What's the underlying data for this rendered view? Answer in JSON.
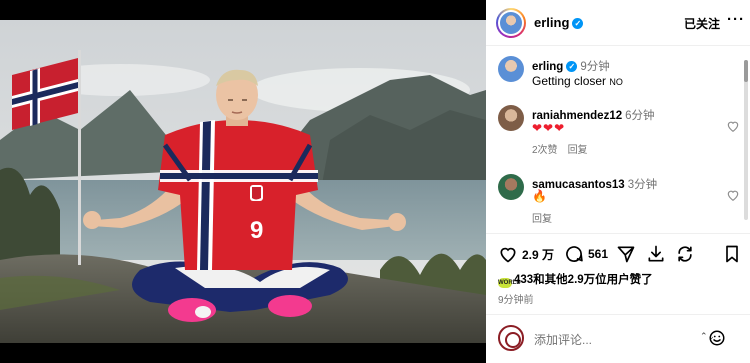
{
  "post": {
    "username": "erling",
    "follow_state": "已关注",
    "more_icon": "more-horizontal-icon"
  },
  "caption": {
    "username": "erling",
    "time": "9分钟",
    "text": "Getting closer",
    "flag": "NO"
  },
  "comments": [
    {
      "username": "raniahmendez12",
      "time": "6分钟",
      "text": "❤❤❤",
      "likes": "2次赞",
      "reply": "回复"
    },
    {
      "username": "samucasantos13",
      "time": "3分钟",
      "text": "🔥",
      "reply": "回复"
    }
  ],
  "actions": {
    "like_count": "2.9 万",
    "comment_count": "561"
  },
  "likes_line": "433和其他2.9万位用户赞了",
  "liker_badge": "WORLD",
  "posted_ago": "9分钟前",
  "comment_input": {
    "placeholder": "添加评论..."
  },
  "colors": {
    "accent_blue": "#0095f6",
    "heart_red": "#ed1e2e",
    "kit_red": "#d8212b",
    "kit_navy": "#1b2a5c"
  }
}
